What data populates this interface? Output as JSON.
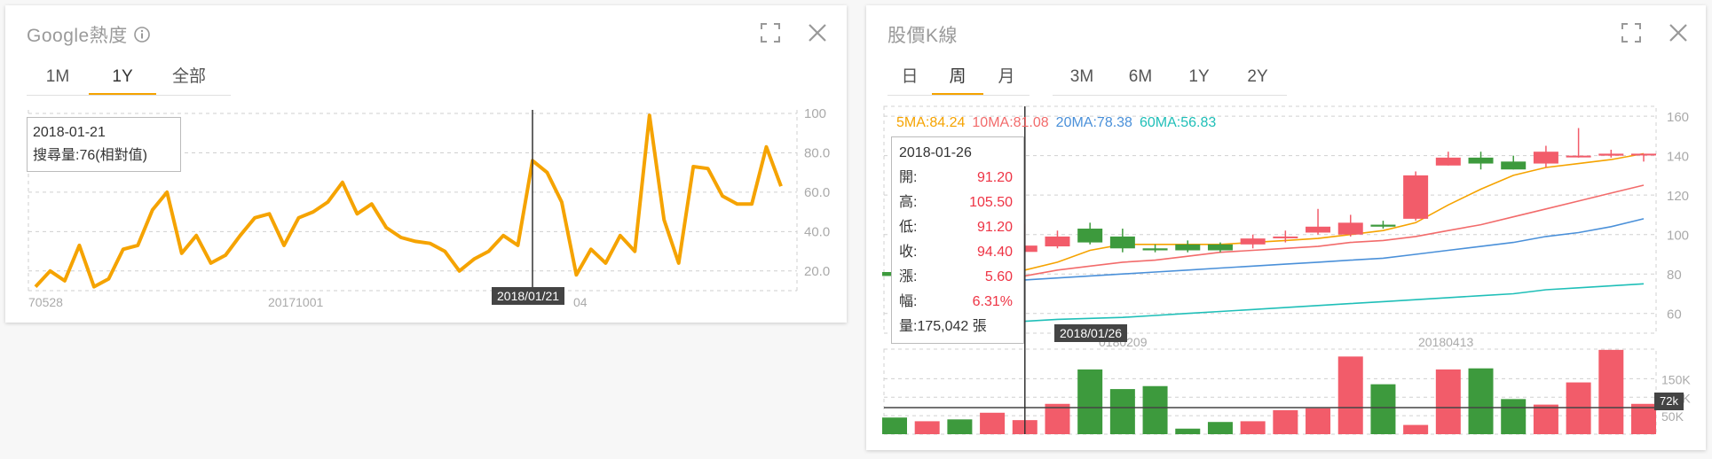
{
  "google_card": {
    "title": "Google熱度",
    "tabs": [
      {
        "label": "1M"
      },
      {
        "label": "1Y"
      },
      {
        "label": "全部"
      }
    ],
    "active_tab": "1Y",
    "tooltip": {
      "date": "2018-01-21",
      "text": "搜尋量:76(相對值)"
    },
    "cursor_badge": "2018/01/21",
    "x_labels": [
      "70528",
      "20171001",
      "04"
    ],
    "y_labels": [
      "100",
      "80.0",
      "60.0",
      "40.0",
      "20.0"
    ]
  },
  "kline_card": {
    "title": "股價K線",
    "tabs_period": [
      {
        "label": "日"
      },
      {
        "label": "周"
      },
      {
        "label": "月"
      }
    ],
    "tabs_range": [
      {
        "label": "3M"
      },
      {
        "label": "6M"
      },
      {
        "label": "1Y"
      },
      {
        "label": "2Y"
      }
    ],
    "active_tab": "周",
    "ma_legend": [
      {
        "label": "5MA:84.24",
        "color": "#f5a300"
      },
      {
        "label": "10MA:81.08",
        "color": "#f26b6b"
      },
      {
        "label": "20MA:78.38",
        "color": "#4a90d9"
      },
      {
        "label": "60MA:56.83",
        "color": "#1fbfb8"
      }
    ],
    "tooltip": {
      "date": "2018-01-26",
      "rows": [
        {
          "label": "開:",
          "value": "91.20"
        },
        {
          "label": "高:",
          "value": "105.50"
        },
        {
          "label": "低:",
          "value": "91.20"
        },
        {
          "label": "收:",
          "value": "94.40"
        },
        {
          "label": "漲:",
          "value": "5.60"
        },
        {
          "label": "幅:",
          "value": "6.31%"
        }
      ],
      "volume": "量:175,042 張"
    },
    "cursor_badge": "2018/01/26",
    "volume_badge": "72k",
    "x_labels": [
      "0180209",
      "20180413"
    ],
    "y_labels_price": [
      "160",
      "140",
      "120",
      "100",
      "80",
      "60"
    ],
    "y_labels_volume": [
      "150K",
      "100K",
      "50K"
    ]
  },
  "chart_data": [
    {
      "type": "line",
      "title": "Google熱度",
      "x_ticks": [
        "70528",
        "20171001",
        "04"
      ],
      "ylim": [
        10,
        100
      ],
      "y_ticks": [
        20,
        40,
        60,
        80,
        100
      ],
      "series": [
        {
          "color": "#f5a300",
          "values": [
            12,
            20,
            15,
            33,
            12,
            16,
            31,
            33,
            51,
            60,
            29,
            38,
            24,
            28,
            38,
            47,
            49,
            33,
            47,
            50,
            55,
            65,
            49,
            54,
            42,
            37,
            35,
            34,
            30,
            20,
            26,
            30,
            38,
            33,
            76,
            70,
            55,
            18,
            31,
            24,
            38,
            30,
            99,
            46,
            24,
            73,
            72,
            58,
            54,
            54,
            83,
            63
          ]
        }
      ]
    },
    {
      "type": "candlestick",
      "title": "股價K線",
      "ylim": [
        50,
        165
      ],
      "y_ticks": [
        60,
        80,
        100,
        120,
        140,
        160
      ],
      "candles": [
        [
          81,
          84,
          76,
          79
        ],
        [
          79,
          83,
          75,
          82
        ],
        [
          81,
          83,
          78,
          79
        ],
        [
          83,
          90,
          82,
          90
        ],
        [
          91.2,
          105.5,
          91.2,
          94.4
        ],
        [
          94,
          102,
          93,
          99
        ],
        [
          103,
          106,
          95,
          96
        ],
        [
          99,
          103,
          91,
          93
        ],
        [
          93,
          95,
          91,
          92
        ],
        [
          95,
          97,
          91,
          92
        ],
        [
          95,
          96,
          91,
          92
        ],
        [
          95,
          100,
          93,
          98
        ],
        [
          99,
          102,
          96,
          99
        ],
        [
          101,
          113,
          100,
          104
        ],
        [
          100,
          110,
          99,
          106
        ],
        [
          105,
          107,
          103,
          104
        ],
        [
          108,
          132,
          107,
          130
        ],
        [
          135,
          142,
          135,
          139
        ],
        [
          139,
          142,
          133,
          136
        ],
        [
          137,
          140,
          133,
          133
        ],
        [
          136,
          145,
          134,
          142
        ],
        [
          140,
          154,
          139,
          140
        ],
        [
          140,
          143,
          139,
          141
        ],
        [
          141,
          141,
          137,
          141
        ]
      ],
      "ma5": [
        76,
        77,
        78,
        80,
        82,
        86,
        92,
        95,
        95,
        95,
        95,
        96,
        97,
        98,
        100,
        102,
        106,
        115,
        123,
        130,
        134,
        136,
        138,
        141
      ],
      "ma10": [
        74,
        75,
        76,
        77,
        79,
        82,
        84,
        86,
        87,
        89,
        91,
        92,
        93,
        94,
        96,
        97,
        99,
        102,
        105,
        109,
        113,
        117,
        121,
        125
      ],
      "ma20": [
        74,
        75,
        75,
        76,
        77,
        78,
        79,
        80,
        81,
        82,
        83,
        84,
        85,
        86,
        87,
        88,
        90,
        92,
        94,
        96,
        99,
        101,
        104,
        108
      ],
      "ma60": [
        53,
        53.5,
        54,
        55,
        56,
        57,
        57.5,
        58,
        59,
        60,
        61,
        62,
        63,
        64,
        65,
        66,
        67,
        68,
        69,
        70,
        72,
        73,
        74,
        75
      ],
      "volume": [
        45,
        35,
        40,
        58,
        38,
        82,
        175,
        122,
        130,
        15,
        33,
        35,
        65,
        70,
        210,
        135,
        25,
        175,
        178,
        95,
        80,
        140,
        228,
        82
      ],
      "volume_ylim": [
        0,
        230
      ],
      "volume_ticks": [
        50,
        100,
        150
      ],
      "volume_ref": 72
    }
  ]
}
